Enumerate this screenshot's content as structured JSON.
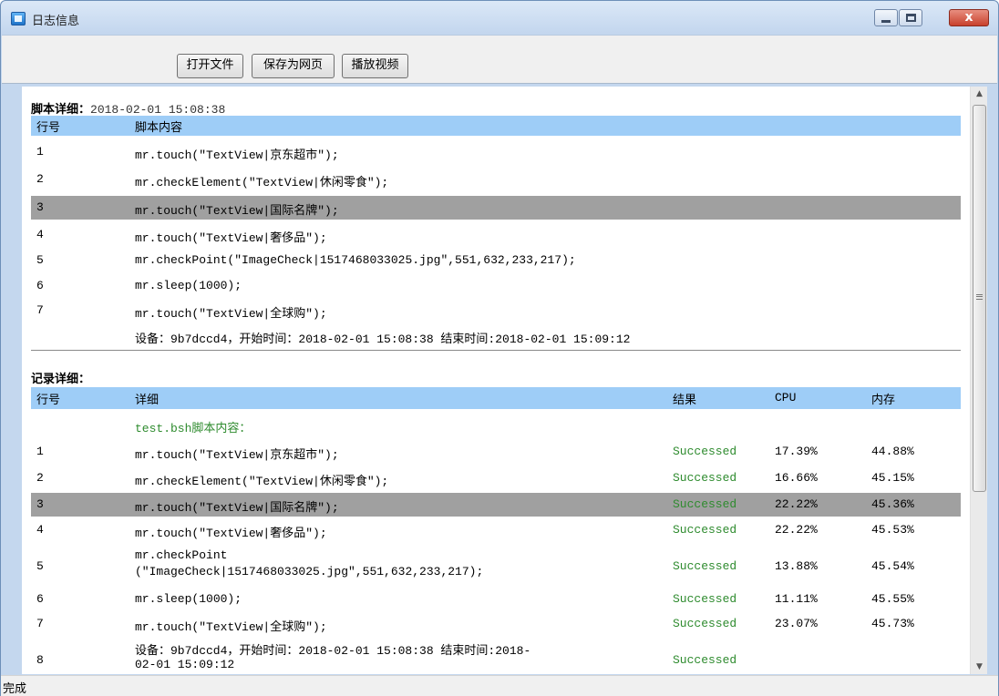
{
  "window": {
    "title": "日志信息"
  },
  "titlebar_buttons": {
    "close": "x"
  },
  "toolbar": {
    "open_label": "打开文件",
    "save_label": "保存为网页",
    "video_label": "播放视频"
  },
  "script_section": {
    "title": "脚本详细：",
    "timestamp": "2018-02-01 15:08:38",
    "headers": {
      "line": "行号",
      "content": "脚本内容"
    },
    "rows": [
      {
        "num": "1",
        "text": "mr.touch(\"TextView|京东超市\");"
      },
      {
        "num": "2",
        "text": "mr.checkElement(\"TextView|休闲零食\");"
      },
      {
        "num": "3",
        "text": "mr.touch(\"TextView|国际名牌\");"
      },
      {
        "num": "4",
        "text": "mr.touch(\"TextView|奢侈品\");"
      },
      {
        "num": "5",
        "text": "mr.checkPoint(\"ImageCheck|1517468033025.jpg\",551,632,233,217);"
      },
      {
        "num": "6",
        "text": "mr.sleep(1000);"
      },
      {
        "num": "7",
        "text": "mr.touch(\"TextView|全球购\");"
      }
    ],
    "device_info": "设备：9b7dccd4，开始时间：2018-02-01 15:08:38 结束时间:2018-02-01 15:09:12"
  },
  "record_section": {
    "title": "记录详细：",
    "headers": {
      "line": "行号",
      "detail": "详细",
      "result": "结果",
      "cpu": "CPU",
      "memory": "内存"
    },
    "intro": "test.bsh脚本内容：",
    "rows": [
      {
        "num": "1",
        "text": "mr.touch(\"TextView|京东超市\");",
        "result": "Successed",
        "cpu": "17.39%",
        "mem": "44.88%"
      },
      {
        "num": "2",
        "text": "mr.checkElement(\"TextView|休闲零食\");",
        "result": "Successed",
        "cpu": "16.66%",
        "mem": "45.15%"
      },
      {
        "num": "3",
        "text": "mr.touch(\"TextView|国际名牌\");",
        "result": "Successed",
        "cpu": "22.22%",
        "mem": "45.36%"
      },
      {
        "num": "4",
        "text": "mr.touch(\"TextView|奢侈品\");",
        "result": "Successed",
        "cpu": "22.22%",
        "mem": "45.53%"
      },
      {
        "num": "5",
        "text_line1": "mr.checkPoint",
        "text_line2": "(\"ImageCheck|1517468033025.jpg\",551,632,233,217);",
        "result": "Successed",
        "cpu": "13.88%",
        "mem": "45.54%"
      },
      {
        "num": "6",
        "text": "mr.sleep(1000);",
        "result": "Successed",
        "cpu": "11.11%",
        "mem": "45.55%"
      },
      {
        "num": "7",
        "text": "mr.touch(\"TextView|全球购\");",
        "result": "Successed",
        "cpu": "23.07%",
        "mem": "45.73%"
      },
      {
        "num": "8",
        "text_line1": "设备：9b7dccd4，开始时间：2018-02-01 15:08:38 结束时间:2018-",
        "text_line2": "02-01 15:09:12",
        "result": "Successed"
      }
    ]
  },
  "status": {
    "text": "完成"
  },
  "colors": {
    "header_bg": "#9ecdf7",
    "highlight_bg": "#a0a0a0",
    "success": "#2e8b2e"
  }
}
